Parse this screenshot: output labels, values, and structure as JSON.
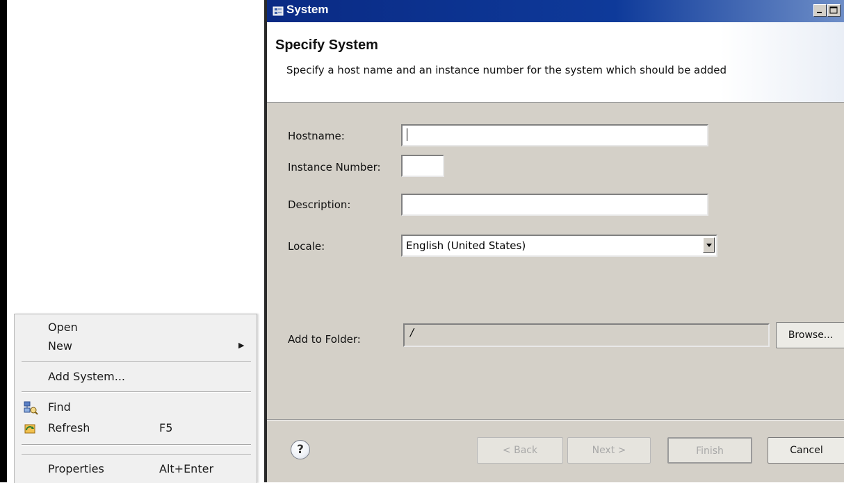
{
  "context_menu": {
    "items": {
      "open": {
        "label": "Open"
      },
      "new": {
        "label": "New"
      },
      "add_system": {
        "label": "Add System..."
      },
      "find": {
        "label": "Find",
        "icon": "find-icon"
      },
      "refresh": {
        "label": "Refresh",
        "shortcut": "F5",
        "icon": "refresh-icon"
      },
      "properties": {
        "label": "Properties",
        "shortcut": "Alt+Enter"
      }
    }
  },
  "dialog": {
    "title": "System",
    "header": {
      "title": "Specify System",
      "description": "Specify a host name and an instance number for the system which should be added"
    },
    "fields": {
      "hostname": {
        "label": "Hostname:",
        "value": ""
      },
      "instance_number": {
        "label": "Instance Number:",
        "value": ""
      },
      "description": {
        "label": "Description:",
        "value": ""
      },
      "locale": {
        "label": "Locale:",
        "value": "English (United States)"
      },
      "add_to_folder": {
        "label": "Add to Folder:",
        "value": "/"
      }
    },
    "buttons": {
      "browse": "Browse...",
      "back": "< Back",
      "next": "Next >",
      "finish": "Finish",
      "cancel": "Cancel"
    }
  }
}
